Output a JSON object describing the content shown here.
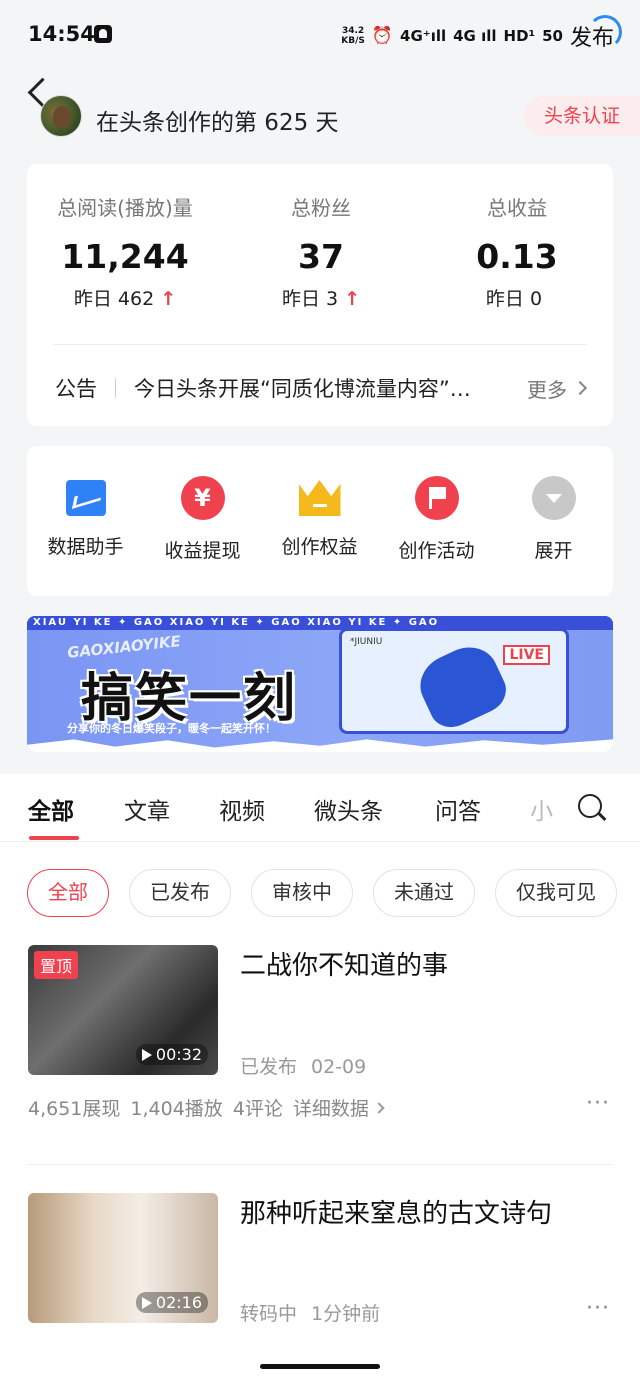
{
  "status_bar": {
    "time": "14:54",
    "net_speed_top": "34.2",
    "net_speed_bottom": "KB/S",
    "alarm_icon": "⏰",
    "wifi_icon": "📶",
    "signal1": "4G⁺ıll",
    "signal2": "4G ıll",
    "hd": "HD¹",
    "battery": "50",
    "publish": "发布"
  },
  "header": {
    "creator_days": "在头条创作的第 625 天",
    "verify_badge": "头条认证"
  },
  "stats": {
    "items": [
      {
        "label": "总阅读(播放)量",
        "value": "11,244",
        "yesterday": "昨日 462",
        "up": "↑"
      },
      {
        "label": "总粉丝",
        "value": "37",
        "yesterday": "昨日 3",
        "up": "↑"
      },
      {
        "label": "总收益",
        "value": "0.13",
        "yesterday": "昨日 0",
        "up": ""
      }
    ],
    "notice_label": "公告",
    "notice_text": "今日头条开展“同质化博流量内容”专项治理",
    "notice_more": "更多"
  },
  "tools": [
    {
      "label": "数据助手",
      "icon": "chart-icon"
    },
    {
      "label": "收益提现",
      "icon": "yen-icon",
      "glyph": "¥"
    },
    {
      "label": "创作权益",
      "icon": "crown-icon"
    },
    {
      "label": "创作活动",
      "icon": "flag-icon"
    },
    {
      "label": "展开",
      "icon": "expand-icon"
    }
  ],
  "banner": {
    "top_strip": "XIAU YI KE ✦ GAO XIAO YI KE ✦ GAO XIAO YI KE ✦ GAO",
    "subtitle_en": "GAOXIAOYIKE",
    "title": "搞笑一刻",
    "subtitle": "分享你的冬日爆笑段子，暖冬一起笑开怀！",
    "live": "LIVE",
    "screen_label": "*JIUNIU"
  },
  "tabs": [
    {
      "label": "全部",
      "active": true
    },
    {
      "label": "文章"
    },
    {
      "label": "视频"
    },
    {
      "label": "微头条"
    },
    {
      "label": "问答"
    },
    {
      "label": "小"
    }
  ],
  "filters": [
    {
      "label": "全部",
      "active": true
    },
    {
      "label": "已发布"
    },
    {
      "label": "审核中"
    },
    {
      "label": "未通过"
    },
    {
      "label": "仅我可见"
    }
  ],
  "items": [
    {
      "pinned": "置顶",
      "duration": "00:32",
      "title": "二战你不知道的事",
      "status": "已发布",
      "date": "02-09",
      "impressions": "4,651展现",
      "plays": "1,404播放",
      "comments": "4评论",
      "detail": "详细数据",
      "more": "···"
    },
    {
      "duration": "02:16",
      "title": "那种听起来窒息的古文诗句",
      "status": "转码中",
      "date": "1分钟前",
      "more": "···"
    }
  ],
  "colors": {
    "accent": "#f0414e",
    "blue": "#2f82f5",
    "gold": "#f5b91e"
  }
}
